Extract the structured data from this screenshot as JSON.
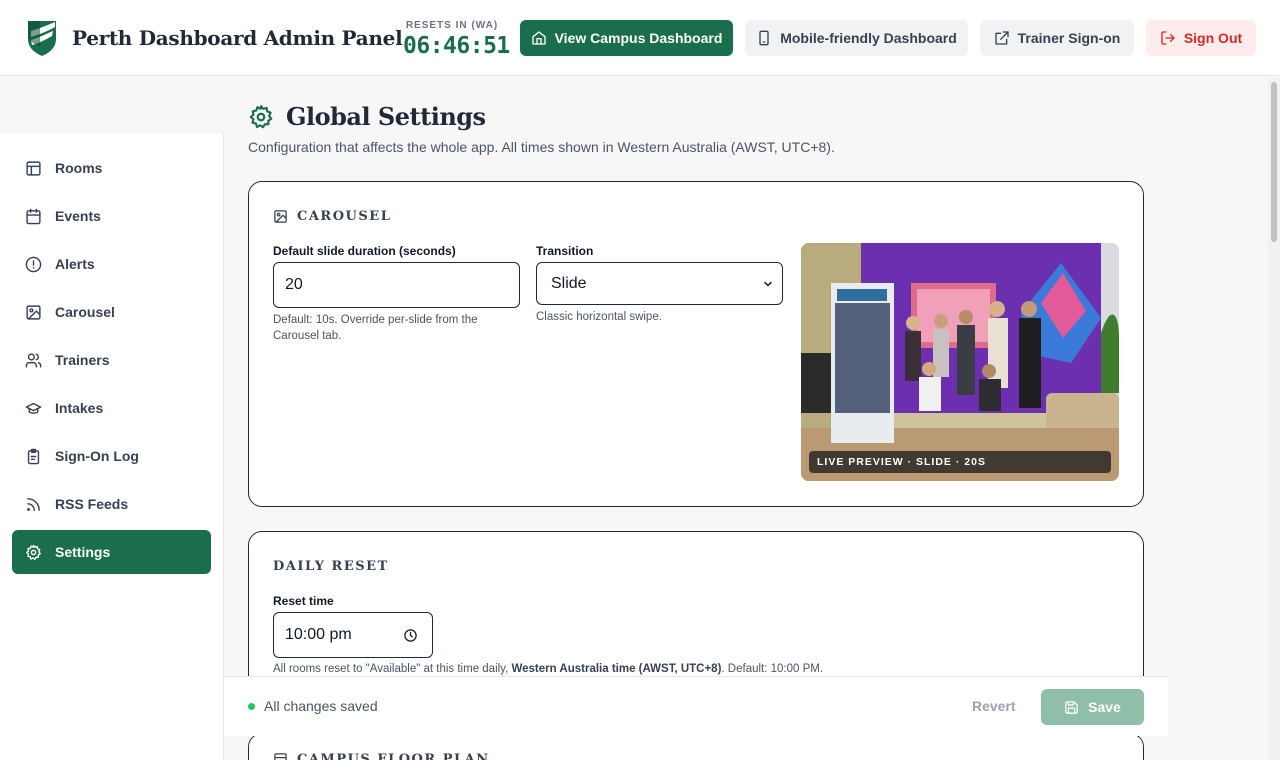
{
  "header": {
    "title": "Perth Dashboard Admin Panel",
    "resets_label": "RESETS IN (WA)",
    "resets_time": "06:46:51",
    "buttons": {
      "campus": "View Campus Dashboard",
      "mobile": "Mobile-friendly Dashboard",
      "trainer": "Trainer Sign-on",
      "signout": "Sign Out"
    }
  },
  "sidebar": {
    "items": [
      {
        "label": "Rooms",
        "icon": "rooms-icon"
      },
      {
        "label": "Events",
        "icon": "calendar-icon"
      },
      {
        "label": "Alerts",
        "icon": "alert-icon"
      },
      {
        "label": "Carousel",
        "icon": "image-icon"
      },
      {
        "label": "Trainers",
        "icon": "users-icon"
      },
      {
        "label": "Intakes",
        "icon": "graduation-cap-icon"
      },
      {
        "label": "Sign-On Log",
        "icon": "clipboard-icon"
      },
      {
        "label": "RSS Feeds",
        "icon": "rss-icon"
      },
      {
        "label": "Settings",
        "icon": "gear-icon",
        "active": true
      }
    ]
  },
  "page": {
    "title": "Global Settings",
    "subtitle": "Configuration that affects the whole app. All times shown in Western Australia (AWST, UTC+8)."
  },
  "carousel": {
    "section_title": "CAROUSEL",
    "duration_label": "Default slide duration (seconds)",
    "duration_value": "20",
    "duration_help": "Default: 10s. Override per-slide from the Carousel tab.",
    "transition_label": "Transition",
    "transition_value": "Slide",
    "transition_help": "Classic horizontal swipe.",
    "preview_badge": "LIVE PREVIEW · SLIDE · 20S"
  },
  "daily_reset": {
    "section_title": "DAILY RESET",
    "time_label": "Reset time",
    "time_value": "10:00 pm",
    "help_prefix": "All rooms reset to \"Available\" at this time daily, ",
    "help_bold": "Western Australia time (AWST, UTC+8)",
    "help_suffix": ". Default: 10:00 PM."
  },
  "floor_plan": {
    "section_title": "CAMPUS FLOOR PLAN"
  },
  "savebar": {
    "status": "All changes saved",
    "revert": "Revert",
    "save": "Save"
  },
  "colors": {
    "brand_green": "#1a6e4d",
    "danger_red": "#dc2626",
    "status_green": "#22c55e"
  }
}
